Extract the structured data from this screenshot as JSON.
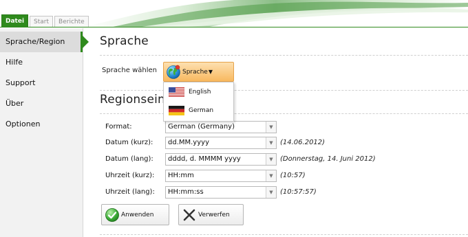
{
  "ribbon": {
    "tabs": [
      {
        "label": "Datei",
        "active": true
      },
      {
        "label": "Start",
        "active": false
      },
      {
        "label": "Berichte",
        "active": false
      }
    ],
    "accent_color": "#2f8a1d"
  },
  "sidebar": {
    "items": [
      {
        "label": "Sprache/Region",
        "active": true
      },
      {
        "label": "Hilfe",
        "active": false
      },
      {
        "label": "Support",
        "active": false
      },
      {
        "label": "Über",
        "active": false
      },
      {
        "label": "Optionen",
        "active": false
      }
    ]
  },
  "language_section": {
    "title": "Sprache",
    "label": "Sprache wählen",
    "button_label": "Sprache",
    "button_icon": "globe-icon",
    "options": [
      {
        "label": "English",
        "icon": "us-flag-icon"
      },
      {
        "label": "German",
        "icon": "german-flag-icon"
      }
    ]
  },
  "region_section": {
    "title": "Regionseinstellungen",
    "rows": [
      {
        "label": "Format:",
        "value": "German (Germany)",
        "example": ""
      },
      {
        "label": "Datum (kurz):",
        "value": "dd.MM.yyyy",
        "example": "(14.06.2012)"
      },
      {
        "label": "Datum (lang):",
        "value": "dddd, d. MMMM yyyy",
        "example": "(Donnerstag, 14. Juni 2012)"
      },
      {
        "label": "Uhrzeit (kurz):",
        "value": "HH:mm",
        "example": "(10:57)"
      },
      {
        "label": "Uhrzeit (lang):",
        "value": "HH:mm:ss",
        "example": "(10:57:57)"
      }
    ]
  },
  "actions": {
    "apply_label": "Anwenden",
    "apply_icon": "check-circle-icon",
    "discard_label": "Verwerfen",
    "discard_icon": "x-icon"
  }
}
